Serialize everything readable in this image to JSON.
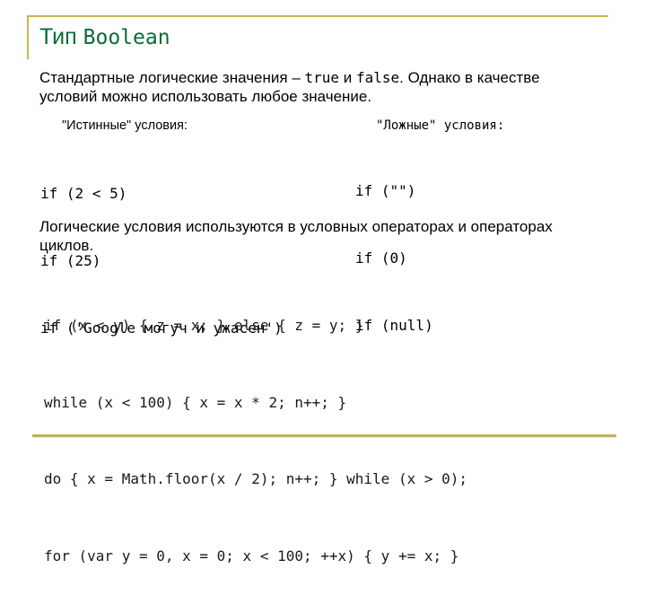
{
  "colors": {
    "title": "#0b6b3a",
    "frame": "#c9b550",
    "text": "#000000"
  },
  "slide": {
    "title_prefix": "Тип",
    "title_code": "Boolean",
    "intro": {
      "part1": "Стандартные логические значения – ",
      "true_kw": "true",
      "and": " и ",
      "false_kw": "false",
      "part2": ". Однако в качестве",
      "line2": "условий можно использовать любое значение."
    },
    "truthy": {
      "heading": "\"Истинные\" условия:",
      "items": [
        "if (2 < 5)",
        "if (25)",
        "if ('Google могуч и ужасен')"
      ]
    },
    "falsy": {
      "heading": "\"Ложные\" условия:",
      "items": [
        "if (\"\")",
        "if (0)",
        "if (null)"
      ]
    },
    "loops_text": {
      "line1": "Логические условия используются в условных операторах и операторах",
      "line2": "циклов."
    },
    "code_examples": [
      "if (x < y) { z = x; } else { z = y; }",
      "while (x < 100) { x = x * 2; n++; }",
      "do { x = Math.floor(x / 2); n++; } while (x > 0);",
      "for (var y = 0, x = 0; x < 100; ++x) { y += x; }"
    ]
  }
}
